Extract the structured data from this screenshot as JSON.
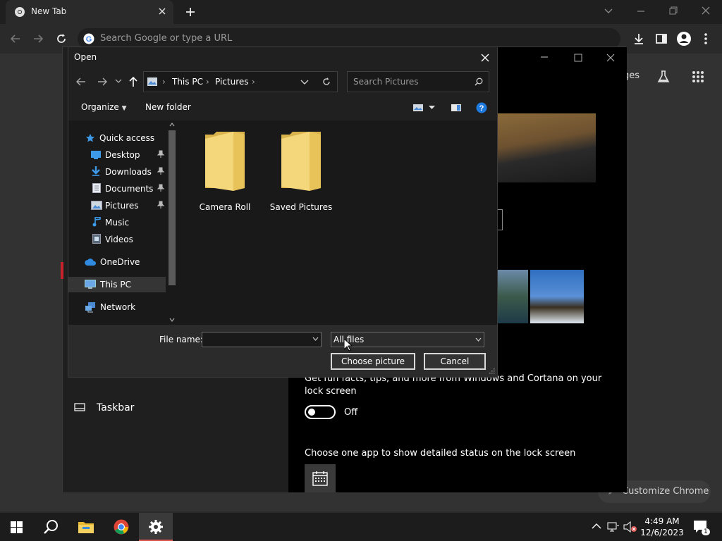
{
  "chrome": {
    "tab_title": "New Tab",
    "omnibox_placeholder": "Search Google or type a URL",
    "images_link_partial": "ges",
    "customize_label": "Customize Chrome"
  },
  "settings": {
    "fun_facts_line1": "Get fun facts, tips, and more from Windows and Cortana on your",
    "fun_facts_line2": "lock screen",
    "toggle_state": "Off",
    "detailed_status_label": "Choose one app to show detailed status on the lock screen",
    "sidebar_taskbar": "Taskbar"
  },
  "dialog": {
    "title": "Open",
    "breadcrumb": [
      "This PC",
      "Pictures"
    ],
    "search_placeholder": "Search Pictures",
    "organize_label": "Organize",
    "new_folder_label": "New folder",
    "nav_items": [
      {
        "label": "Quick access",
        "icon": "star-icon"
      },
      {
        "label": "Desktop",
        "icon": "desktop-icon",
        "pinned": true
      },
      {
        "label": "Downloads",
        "icon": "download-icon",
        "pinned": true
      },
      {
        "label": "Documents",
        "icon": "document-icon",
        "pinned": true
      },
      {
        "label": "Pictures",
        "icon": "pictures-icon",
        "pinned": true
      },
      {
        "label": "Music",
        "icon": "music-icon"
      },
      {
        "label": "Videos",
        "icon": "video-icon"
      },
      {
        "label": "OneDrive",
        "icon": "cloud-icon"
      },
      {
        "label": "This PC",
        "icon": "computer-icon",
        "selected": true
      },
      {
        "label": "Network",
        "icon": "network-icon"
      }
    ],
    "folders": [
      "Camera Roll",
      "Saved Pictures"
    ],
    "file_name_label": "File name:",
    "file_name_value": "",
    "file_type_filter": "All files",
    "choose_button": "Choose picture",
    "cancel_button": "Cancel"
  },
  "system_tray": {
    "time": "4:49 AM",
    "date": "12/6/2023",
    "notification_count": "1"
  },
  "colors": {
    "accent_blue": "#0078d4",
    "folder_yellow": "#f2c94c",
    "onedrive_blue": "#2f8ae0"
  }
}
